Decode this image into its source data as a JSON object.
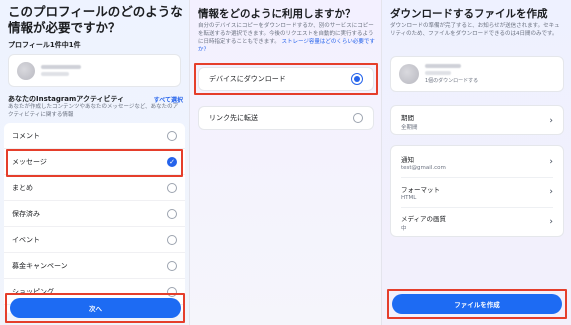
{
  "panel1": {
    "title": "このプロフィールのどのような情報が必要ですか？",
    "subtitle": "プロフィール1件中1件",
    "activity_title": "あなたのInstagramアクティビティ",
    "see_all": "すべて選択",
    "activity_desc": "あなたが作成したコンテンツやあなたのメッセージなど、あなたのアクティビティに関する情報",
    "items": [
      {
        "label": "コメント",
        "selected": false
      },
      {
        "label": "メッセージ",
        "selected": true
      },
      {
        "label": "まとめ",
        "selected": false
      },
      {
        "label": "保存済み",
        "selected": false
      },
      {
        "label": "イベント",
        "selected": false
      },
      {
        "label": "募金キャンペーン",
        "selected": false
      },
      {
        "label": "ショッピング",
        "selected": false
      }
    ],
    "next_button": "次へ"
  },
  "panel2": {
    "title": "情報をどのように利用しますか？",
    "desc": "自分のデバイスにコピーをダウンロードするか、別のサービスにコピーを転送するか選択できます。今後のリクエストを自動的に実行するように日時指定することもできます。",
    "desc_link": "ストレージ容量はどのくらい必要ですか？",
    "options": [
      {
        "label": "デバイスにダウンロード",
        "selected": true
      },
      {
        "label": "リンク先に転送",
        "selected": false
      }
    ]
  },
  "panel3": {
    "title": "ダウンロードするファイルを作成",
    "desc": "ダウンロードの準備が完了すると、お知らせが送信されます。セキュリティのため、ファイルをダウンロードできるのは4日間のみです。",
    "profile_caption": "1個のダウンロードする",
    "period_label": "期間",
    "period_value": "全期間",
    "settings": [
      {
        "label": "通知",
        "value": "test@gmail.com"
      },
      {
        "label": "フォーマット",
        "value": "HTML"
      },
      {
        "label": "メディアの画質",
        "value": "中"
      }
    ],
    "create_button": "ファイルを作成"
  },
  "colors": {
    "accent": "#1d6bf3",
    "highlight": "#e53e2b"
  },
  "icons": {
    "chevron": "chevron-right-icon",
    "check": "check-icon"
  }
}
